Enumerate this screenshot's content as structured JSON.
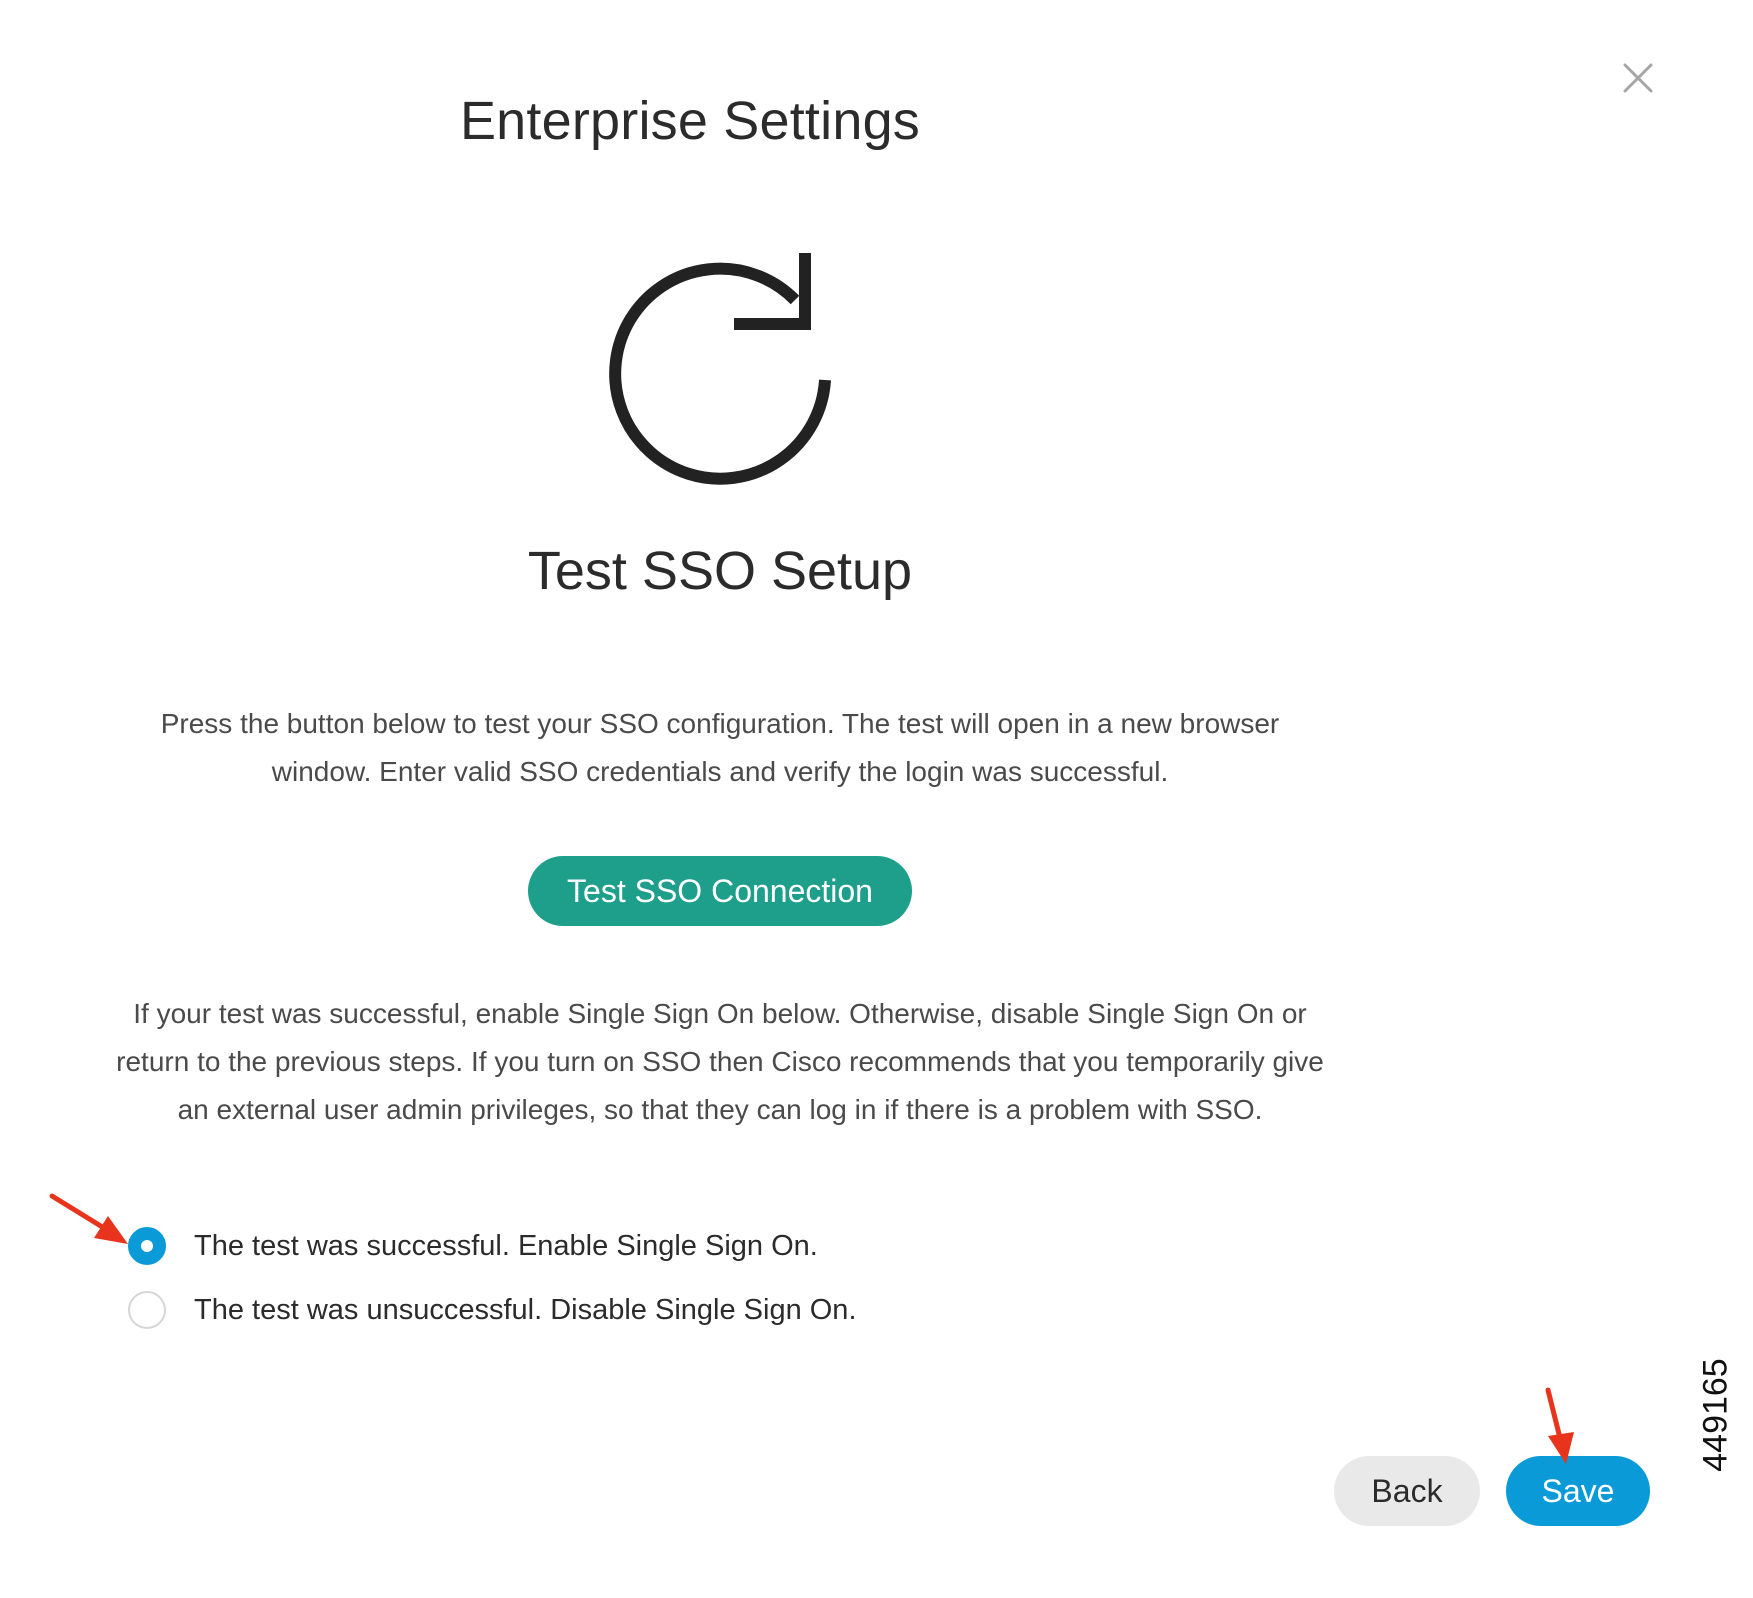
{
  "dialog": {
    "title": "Enterprise Settings",
    "close_icon": "close-icon"
  },
  "hero": {
    "icon": "refresh-icon"
  },
  "section": {
    "title": "Test SSO Setup",
    "instructions": "Press the button below to test your SSO configuration. The test will open in a new browser window. Enter valid SSO credentials and verify the login was successful.",
    "test_button_label": "Test SSO Connection",
    "note": "If your test was successful, enable Single Sign On below. Otherwise, disable Single Sign On or return to the previous steps. If you turn on SSO then Cisco recommends that you temporarily give an external user admin privileges, so that they can log in if there is a problem with SSO."
  },
  "options": [
    {
      "label": "The test was successful. Enable Single Sign On.",
      "selected": true
    },
    {
      "label": "The test was unsuccessful. Disable Single Sign On.",
      "selected": false
    }
  ],
  "footer": {
    "back_label": "Back",
    "save_label": "Save"
  },
  "annotations": {
    "figure_id": "449165",
    "arrow_icon": "red-arrow-icon"
  },
  "colors": {
    "accent_teal": "#1e9f8c",
    "accent_blue": "#0a9ad8",
    "arrow_red": "#e8341c",
    "secondary_button": "#e9e9e9"
  }
}
